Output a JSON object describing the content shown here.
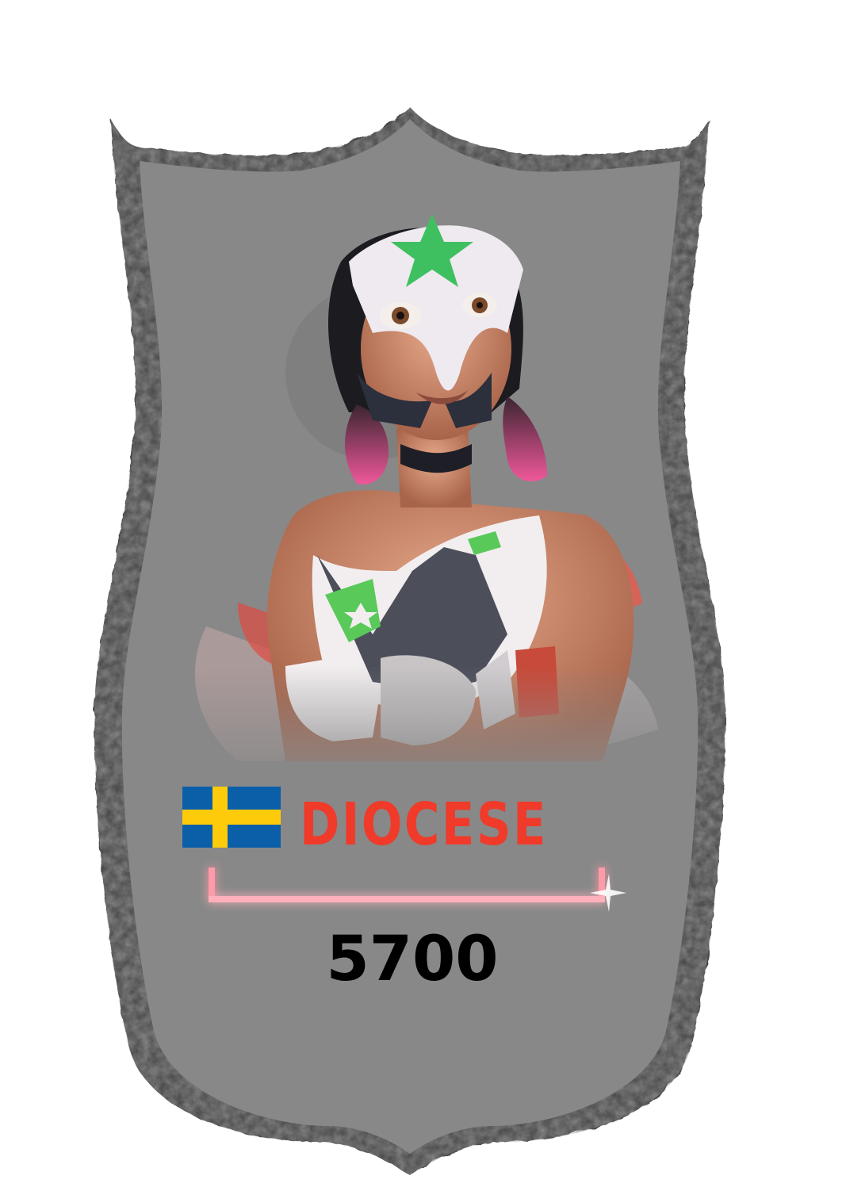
{
  "player": {
    "name": "DIOCESE",
    "country_flag": "sweden-flag-icon",
    "score": "5700"
  },
  "colors": {
    "shield_fill": "#888888",
    "shield_border": "#3f3f3f",
    "name_red": "#f03a2a",
    "flag_blue": "#0a5fa8",
    "flag_yellow": "#fdcb0a",
    "neon_bar": "#ff7a8a",
    "score_text": "#000000"
  },
  "character": {
    "portrait": "masked-wrestler-character-icon"
  }
}
